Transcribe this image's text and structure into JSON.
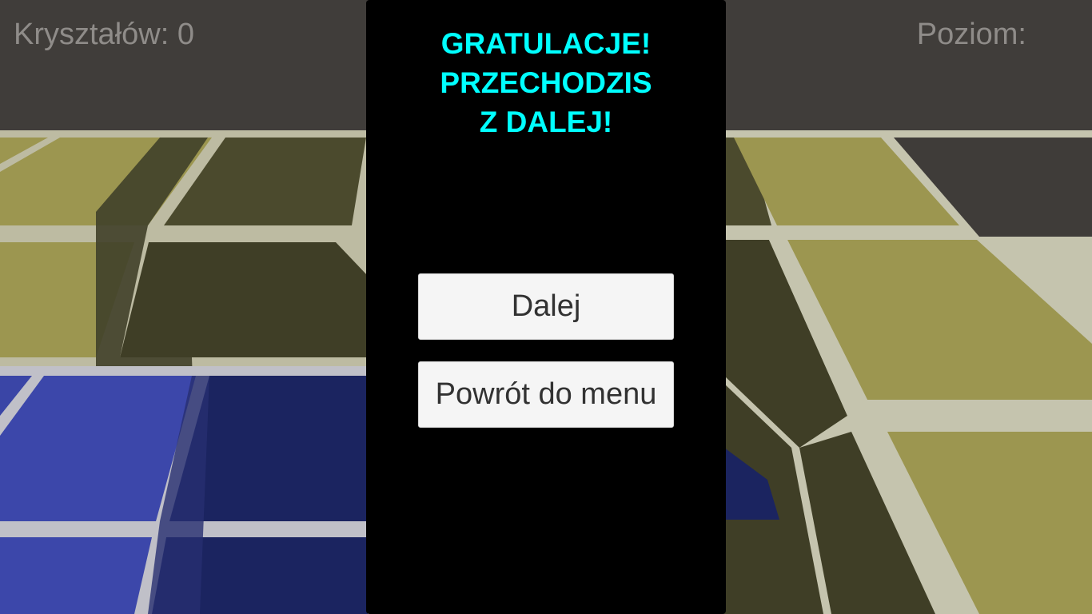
{
  "hud": {
    "crystals_label": "Kryształów:",
    "crystals_value": "0",
    "level_label": "Poziom:"
  },
  "dialog": {
    "title_lines": [
      "GRATULACJE!",
      "PRZECHODZIS",
      "Z DALEJ!"
    ],
    "next_label": "Dalej",
    "menu_label": "Powrót do menu"
  },
  "colors": {
    "title": "#00ffff",
    "panel": "#000000",
    "hud_text": "#8f8c89",
    "button_bg": "#f5f5f5",
    "tile_yellow": "#9a944c",
    "tile_blue": "#3c46a8",
    "grid_lines": "#c9c7b0"
  }
}
